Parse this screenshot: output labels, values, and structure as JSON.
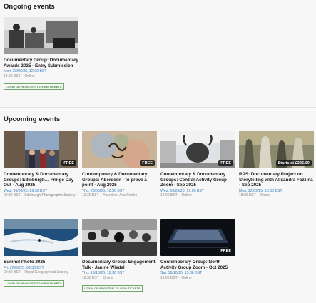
{
  "sections": {
    "ongoing": "Ongoing events",
    "upcoming": "Upcoming events"
  },
  "ongoing_events": [
    {
      "title": "Documentary Group: Documentary Awards 2025 - Entry Submission",
      "date": "Mon, 23/06/25, 12:00 BST",
      "time": "12:00 BST",
      "location": "Online",
      "ticket_label": "LOGIN OR REGISTER TO VIEW TICKETS"
    }
  ],
  "upcoming_events": [
    {
      "title": "Contemporary & Documentary Groups: Edinburgh… Fringe Day Out - Aug 2025",
      "date": "Wed, 06/08/25, 09:30 BST",
      "time": "09:30 BST",
      "location": "Edinburgh Photographic Society",
      "badge": "FREE"
    },
    {
      "title": "Contemporary & Documentary Groups: Aberdeen - to prove a point - Aug 2025",
      "date": "Thu, 28/08/25, 10:30 BST",
      "time": "10:30 BST",
      "location": "Aberdeen Arts Centre",
      "badge": "FREE"
    },
    {
      "title": "Contemporary & Documentary Groups: Central Activity Group Zoom - Sep 2025",
      "date": "Wed, 10/09/25, 19:00 BST",
      "time": "19:00 BST",
      "location": "Online",
      "badge": "FREE"
    },
    {
      "title": "RPS: Documentary Project on Storytelling with Alixandra Fazzina - Sep 2025",
      "date": "Mon, 22/09/25, 18:00 BST",
      "time": "18:00 BST",
      "location": "Online",
      "badge": "Starts at £225.00"
    },
    {
      "title": "Summit Photo 2025",
      "date": "Fri, 26/09/25, 09:30 BST",
      "time": "09:30 BST",
      "location": "Royal Geographical Society",
      "ticket_label": "LOGIN OR REGISTER TO VIEW TICKETS"
    },
    {
      "title": "Documentary Group: Engagement Talk - Janine Wiedel",
      "date": "Thu, 16/10/25, 18:30 BST",
      "time": "18:30 BST",
      "location": "Online",
      "ticket_label": "LOGIN OR REGISTER TO VIEW TICKETS"
    },
    {
      "title": "Contemporary Group: North Activity Group Zoom - Oct 2025",
      "date": "Sat, 18/10/25, 13:00 BST",
      "time": "13:00 BST",
      "location": "Online",
      "badge": "FREE"
    }
  ]
}
